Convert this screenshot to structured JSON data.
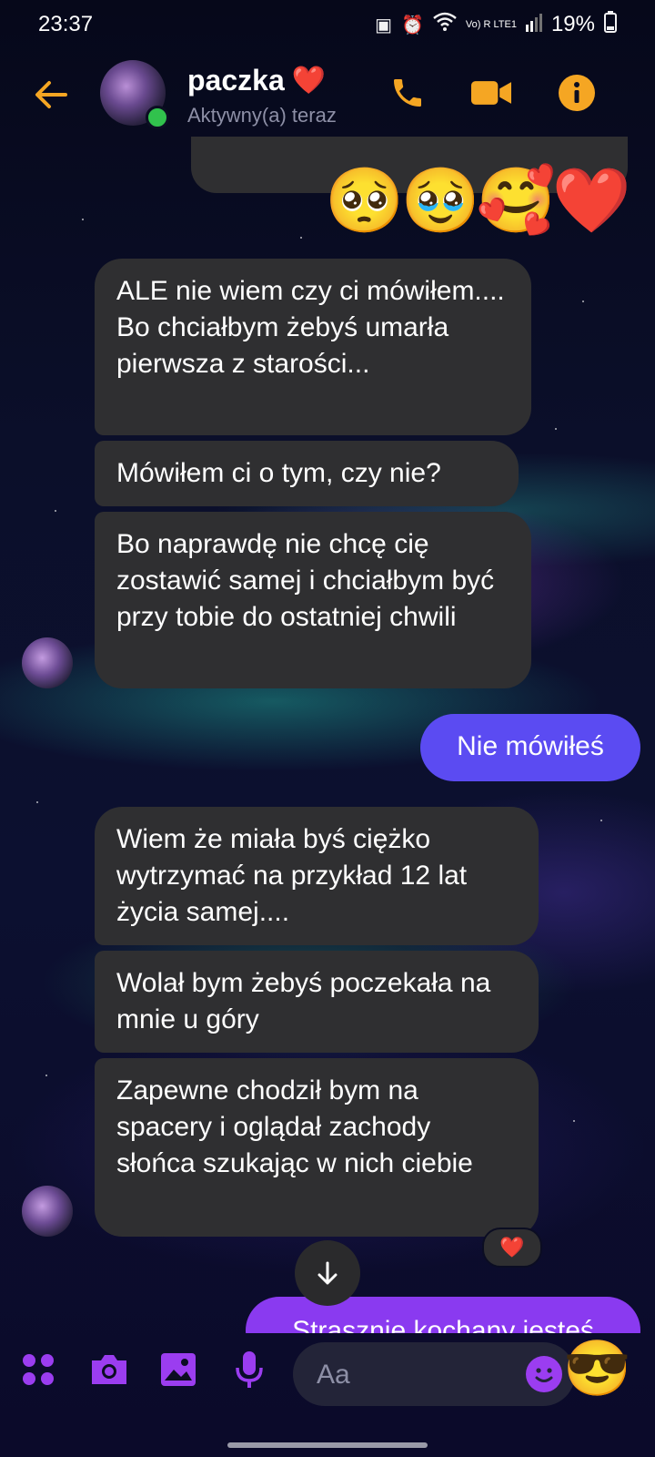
{
  "status_bar": {
    "time": "23:37",
    "signal": "Vo) R LTE1",
    "battery": "19%"
  },
  "header": {
    "contact_name": "paczka",
    "name_emoji": "❤️",
    "status_text": "Aktywny(a) teraz"
  },
  "icons": {
    "back": "back-arrow-icon",
    "call": "phone-icon",
    "video": "video-camera-icon",
    "info": "info-icon"
  },
  "emoji_message": "🥺🥹🥰❤️",
  "messages": [
    {
      "sender": "them",
      "text": "ALE nie wiem czy ci mówiłem.... Bo chciałbym żebyś umarła pierwsza z starości..."
    },
    {
      "sender": "them",
      "text": "Mówiłem ci o tym, czy nie?"
    },
    {
      "sender": "them",
      "text": "Bo naprawdę nie chcę cię zostawić samej i chciałbym być przy tobie do ostatniej chwili"
    },
    {
      "sender": "me",
      "text": "Nie mówiłeś"
    },
    {
      "sender": "them",
      "text": "Wiem że miała byś ciężko wytrzymać na przykład 12 lat życia samej...."
    },
    {
      "sender": "them",
      "text": "Wolał bym żebyś poczekała na mnie u góry"
    },
    {
      "sender": "them",
      "text": "Zapewne chodził bym na spacery i oglądał zachody słońca szukając w nich ciebie"
    },
    {
      "sender": "me",
      "text": "Strasznie kochany jesteś"
    }
  ],
  "reaction": "❤️",
  "composer": {
    "placeholder": "Aa",
    "quick_emoji": "😎"
  },
  "colors": {
    "accent": "#f5a623",
    "my_bubble": "#5b4bf2",
    "my_bubble_2": "#8a3af0",
    "their_bubble": "#2f2f31",
    "composer_icons": "#9b3df0"
  }
}
